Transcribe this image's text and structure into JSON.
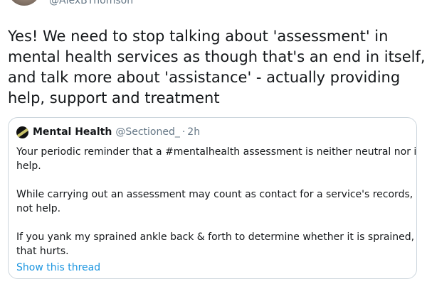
{
  "author": {
    "handle": "@AlexBThomson"
  },
  "tweet": {
    "lines": [
      "Yes! We need to stop talking about 'assessment' in",
      "mental health services as though that's an end in itself,",
      "and talk more about 'assistance' - actually providing",
      "help, support and treatment"
    ]
  },
  "quote": {
    "name": "Mental Health",
    "handle": "@Sectioned_",
    "separator": "·",
    "time": "2h",
    "paragraphs": [
      {
        "lines": [
          "Your periodic reminder that a #mentalhealth assessment is neither neutral nor is it",
          "help."
        ]
      },
      {
        "lines": [
          "While carrying out an assessment may count as contact for a service's records, it is",
          "not help."
        ]
      },
      {
        "lines": [
          "If you yank my sprained ankle back & forth to determine whether it is sprained,",
          "that hurts."
        ]
      }
    ],
    "show_thread_label": "Show this thread"
  },
  "colors": {
    "link": "#1b95e0",
    "secondary_text": "#657786",
    "border": "#ccd6dd"
  }
}
